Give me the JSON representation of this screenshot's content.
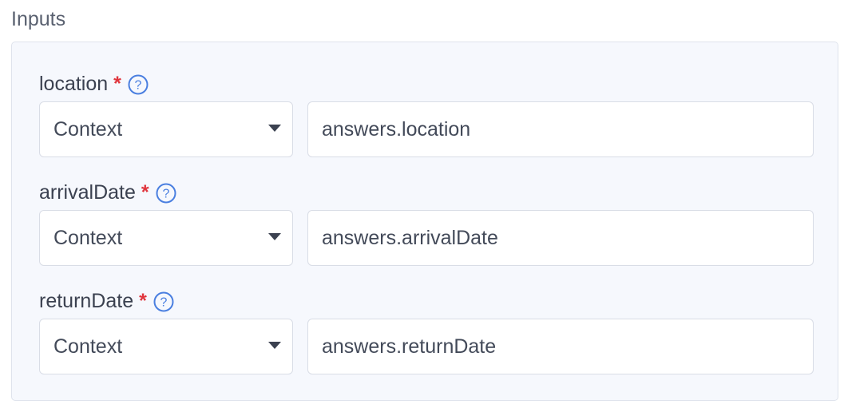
{
  "section": {
    "title": "Inputs"
  },
  "fields": [
    {
      "name": "location",
      "required_mark": "*",
      "source": "Context",
      "value": "answers.location"
    },
    {
      "name": "arrivalDate",
      "required_mark": "*",
      "source": "Context",
      "value": "answers.arrivalDate"
    },
    {
      "name": "returnDate",
      "required_mark": "*",
      "source": "Context",
      "value": "answers.returnDate"
    }
  ],
  "icons": {
    "help": "help-icon",
    "dropdown": "chevron-down-icon"
  },
  "colors": {
    "required": "#e0353d",
    "help_icon": "#4a7fe0",
    "panel_background": "#f6f8fd"
  }
}
